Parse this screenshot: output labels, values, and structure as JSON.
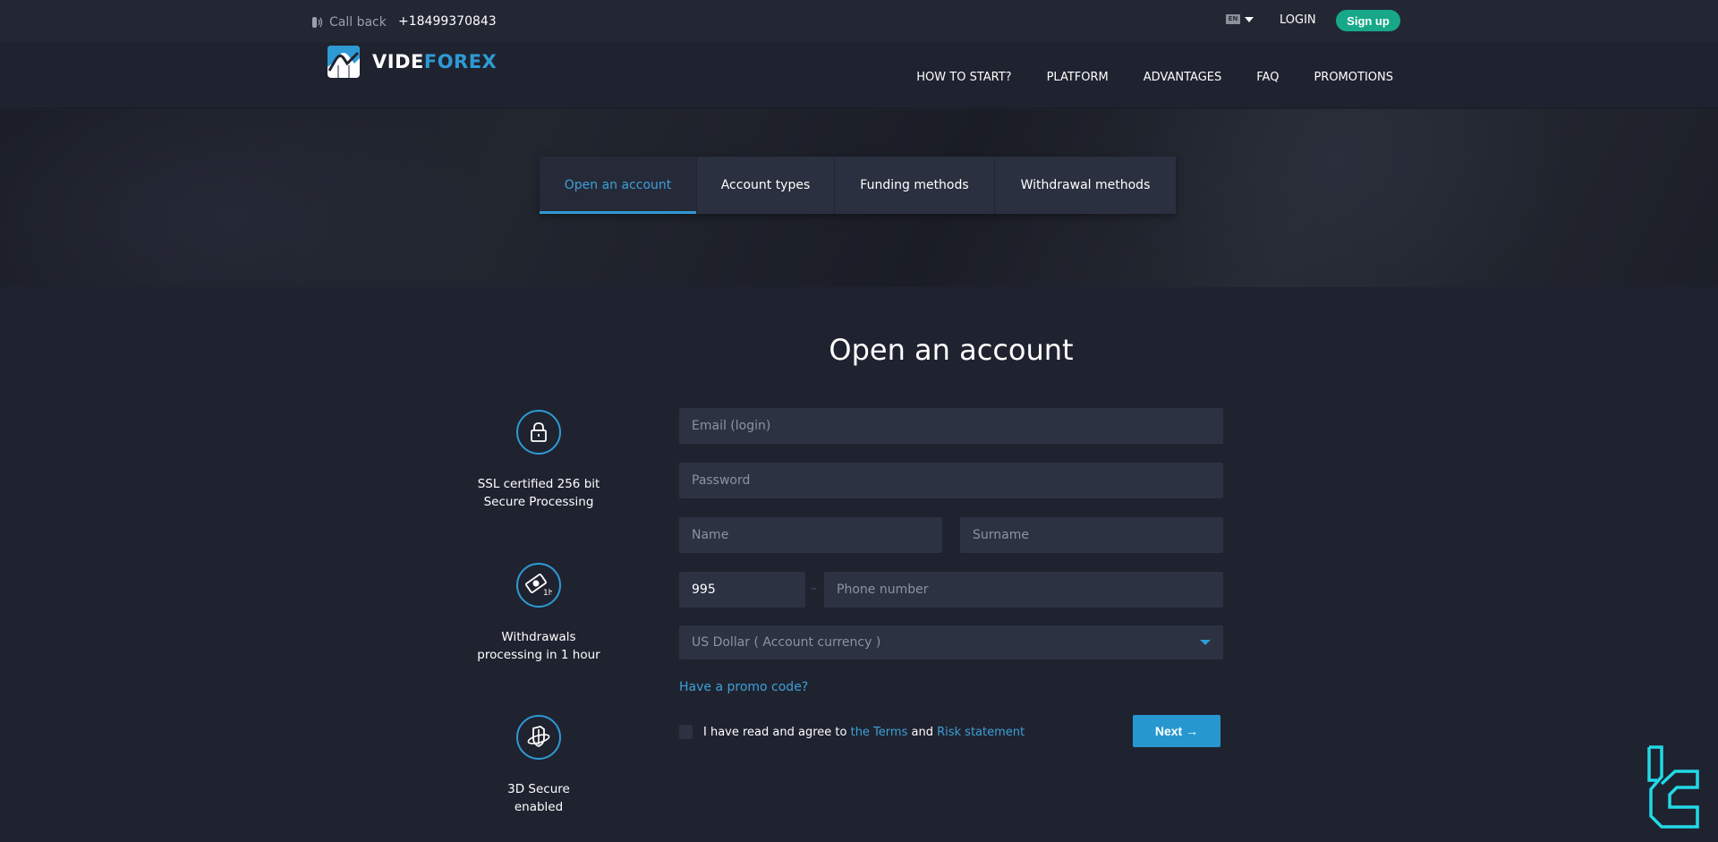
{
  "topbar": {
    "callback_label": "Call back",
    "phone_number": "+18499370843",
    "language": "EN",
    "login_label": "LOGIN",
    "signup_label": "Sign up"
  },
  "header": {
    "logo_part1": "VIDE",
    "logo_part2": "FOREX",
    "nav": [
      {
        "label": "HOW TO START?"
      },
      {
        "label": "PLATFORM"
      },
      {
        "label": "ADVANTAGES"
      },
      {
        "label": "FAQ"
      },
      {
        "label": "PROMOTIONS"
      }
    ]
  },
  "tabs": [
    {
      "label": "Open an account",
      "active": true
    },
    {
      "label": "Account types",
      "active": false
    },
    {
      "label": "Funding methods",
      "active": false
    },
    {
      "label": "Withdrawal methods",
      "active": false
    }
  ],
  "form": {
    "title": "Open an account",
    "email_placeholder": "Email (login)",
    "password_placeholder": "Password",
    "name_placeholder": "Name",
    "surname_placeholder": "Surname",
    "country_code_value": "995",
    "phone_separator": "–",
    "phone_placeholder": "Phone number",
    "currency_selected": "US Dollar ( Account currency )",
    "promo_link": "Have a promo code?",
    "agree_text": "I have read and agree to",
    "terms_link": "the Terms",
    "and_text": "and",
    "risk_link": "Risk statement",
    "next_label": "Next →"
  },
  "features": [
    {
      "icon": "lock-icon",
      "line1": "SSL certified 256 bit",
      "line2": "Secure Processing"
    },
    {
      "icon": "money-clock-icon",
      "line1": "Withdrawals",
      "line2": "processing in 1 hour"
    },
    {
      "icon": "shield-3d-icon",
      "line1": "3D Secure",
      "line2": "enabled"
    }
  ],
  "colors": {
    "accent": "#2e9ad3",
    "signup": "#17a889",
    "background": "#1f2330",
    "field": "#2c3242"
  }
}
